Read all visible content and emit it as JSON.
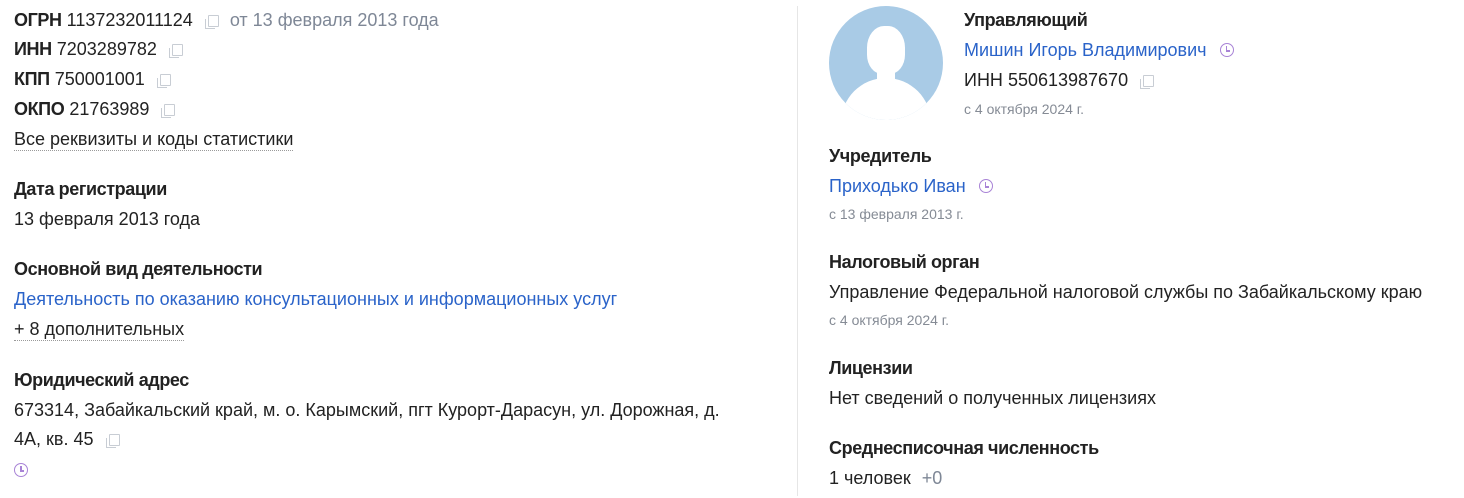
{
  "codes": {
    "ogrn_label": "ОГРН",
    "ogrn_value": "1137232011124",
    "ogrn_date": "от 13 февраля 2013 года",
    "inn_label": "ИНН",
    "inn_value": "7203289782",
    "kpp_label": "КПП",
    "kpp_value": "750001001",
    "okpo_label": "ОКПО",
    "okpo_value": "21763989",
    "all_link": "Все реквизиты и коды статистики"
  },
  "registration": {
    "heading": "Дата регистрации",
    "value": "13 февраля 2013 года"
  },
  "activity": {
    "heading": "Основной вид деятельности",
    "main": "Деятельность по оказанию консультационных и информационных услуг",
    "more": "+ 8 дополнительных"
  },
  "address": {
    "heading": "Юридический адрес",
    "line1": "673314, Забайкальский край, м. о. Карымский, пгт Курорт-Дарасун, ул. Дорожная, д.",
    "line2": "4А, кв. 45"
  },
  "manager": {
    "heading": "Управляющий",
    "name": "Мишин Игорь Владимирович",
    "inn_label": "ИНН",
    "inn_value": "550613987670",
    "since": "с 4 октября 2024 г."
  },
  "founder": {
    "heading": "Учредитель",
    "name": "Приходько Иван",
    "since": "с 13 февраля 2013 г."
  },
  "tax": {
    "heading": "Налоговый орган",
    "value": "Управление Федеральной налоговой службы по Забайкальскому краю",
    "since": "с 4 октября 2024 г."
  },
  "licenses": {
    "heading": "Лицензии",
    "value": "Нет сведений о полученных лицензиях"
  },
  "headcount": {
    "heading": "Среднесписочная численность",
    "value": "1 человек",
    "delta": "+0"
  },
  "colors": {
    "link": "#2a63c9",
    "muted": "#7e8796",
    "history_icon": "#a883d6",
    "avatar": "#a9cbe6"
  }
}
